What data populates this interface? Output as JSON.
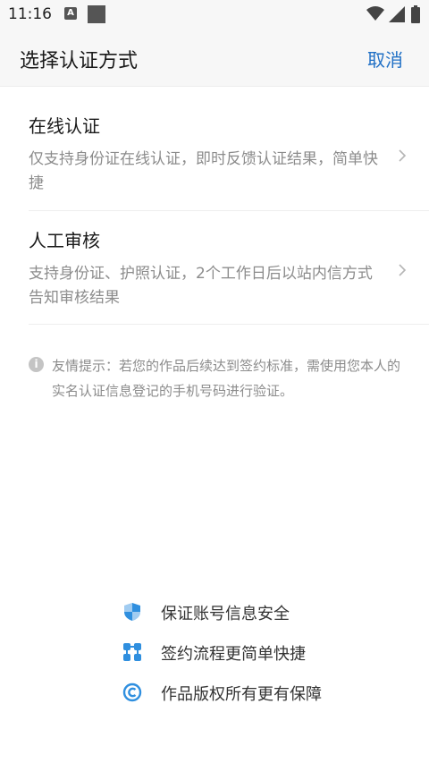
{
  "status_bar": {
    "time": "11:16",
    "notification_badge": "A"
  },
  "header": {
    "title": "选择认证方式",
    "cancel_label": "取消"
  },
  "options": [
    {
      "title": "在线认证",
      "description": "仅支持身份证在线认证，即时反馈认证结果，简单快捷"
    },
    {
      "title": "人工审核",
      "description": "支持身份证、护照认证，2个工作日后以站内信方式告知审核结果"
    }
  ],
  "tip": {
    "text": "友情提示：若您的作品后续达到签约标准，需使用您本人的实名认证信息登记的手机号码进行验证。"
  },
  "features": [
    {
      "label": "保证账号信息安全",
      "icon": "shield-icon"
    },
    {
      "label": "签约流程更简单快捷",
      "icon": "flow-icon"
    },
    {
      "label": "作品版权所有更有保障",
      "icon": "copyright-icon"
    }
  ],
  "colors": {
    "accent": "#1f6fc5",
    "icon_blue": "#2f8fdf",
    "text_muted": "#8c8c8c"
  }
}
